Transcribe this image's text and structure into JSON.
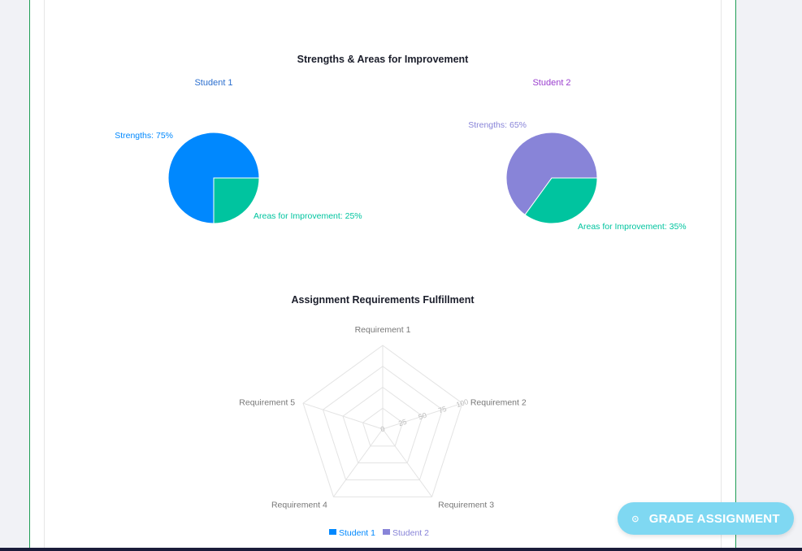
{
  "chart_data": [
    {
      "type": "pie",
      "title": "Strengths & Areas for Improvement",
      "subtitle": "Student 1",
      "categories": [
        "Strengths",
        "Areas for Improvement"
      ],
      "values": [
        75,
        25
      ],
      "labels": [
        "Strengths: 75%",
        "Areas for Improvement: 25%"
      ],
      "colors": [
        "#0088fe",
        "#00c49f"
      ]
    },
    {
      "type": "pie",
      "title": "Strengths & Areas for Improvement",
      "subtitle": "Student 2",
      "categories": [
        "Strengths",
        "Areas for Improvement"
      ],
      "values": [
        65,
        35
      ],
      "labels": [
        "Strengths: 65%",
        "Areas for Improvement: 35%"
      ],
      "colors": [
        "#8884d8",
        "#00c49f"
      ]
    },
    {
      "type": "radar",
      "title": "Assignment Requirements Fulfillment",
      "axes": [
        "Requirement 1",
        "Requirement 2",
        "Requirement 3",
        "Requirement 4",
        "Requirement 5"
      ],
      "radial_ticks": [
        "0",
        "25",
        "50",
        "75",
        "100"
      ],
      "rlim": [
        0,
        100
      ],
      "series": [
        {
          "name": "Student 1",
          "color": "#0088fe"
        },
        {
          "name": "Student 2",
          "color": "#8884d8"
        }
      ],
      "legend_position": "bottom"
    }
  ],
  "page": {
    "pie_section_title": "Strengths & Areas for Improvement",
    "student1_title": "Student 1",
    "student2_title": "Student 2",
    "student1_title_color": "#2c6fcf",
    "student2_title_color": "#9b3fcf",
    "radar_title": "Assignment Requirements Fulfillment"
  },
  "action": {
    "grade_label": "GRADE ASSIGNMENT",
    "grade_icon": "check-circle-icon",
    "grade_color": "#7fd8f2"
  }
}
